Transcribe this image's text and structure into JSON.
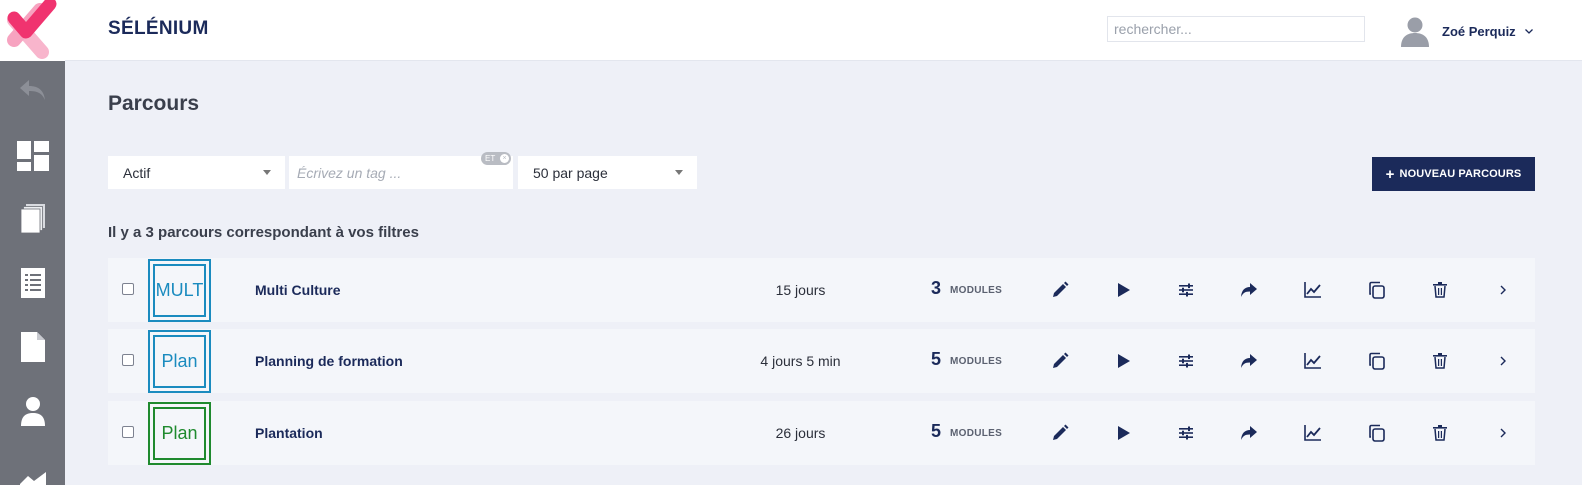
{
  "header": {
    "brand": "SÉLÉNIUM",
    "search_placeholder": "rechercher...",
    "user_name": "Zoé Perquiz"
  },
  "sidebar": {
    "items": [
      {
        "icon": "back-arrow-icon"
      },
      {
        "icon": "dashboard-icon"
      },
      {
        "icon": "stack-pages-icon"
      },
      {
        "icon": "list-icon"
      },
      {
        "icon": "document-icon"
      },
      {
        "icon": "user-icon"
      },
      {
        "icon": "chart-icon"
      }
    ]
  },
  "main": {
    "title": "Parcours",
    "filters": {
      "status": "Actif",
      "tag_placeholder": "Écrivez un tag ...",
      "tag_mode": "ET",
      "per_page": "50 par page"
    },
    "new_button_label": "NOUVEAU PARCOURS",
    "result_count": "Il y a 3 parcours correspondant à vos filtres",
    "modules_label": "MODULES",
    "rows": [
      {
        "thumb": "MULT",
        "thumb_color": "#1a8bbf",
        "name": "Multi Culture",
        "duration": "15 jours",
        "modules": "3"
      },
      {
        "thumb": "Plan",
        "thumb_color": "#1a8bbf",
        "name": "Planning de formation",
        "duration": "4 jours 5 min",
        "modules": "5"
      },
      {
        "thumb": "Plan",
        "thumb_color": "#1f8a2e",
        "name": "Plantation",
        "duration": "26 jours",
        "modules": "5"
      }
    ],
    "row_actions": [
      "edit-icon",
      "play-icon",
      "settings-sliders-icon",
      "share-icon",
      "stats-icon",
      "duplicate-icon",
      "delete-icon",
      "chevron-right-icon"
    ]
  },
  "colors": {
    "primary": "#1b2a5a",
    "sidebar": "#6e7179",
    "background": "#eef0f7",
    "logo_pink": "#f0336f"
  }
}
